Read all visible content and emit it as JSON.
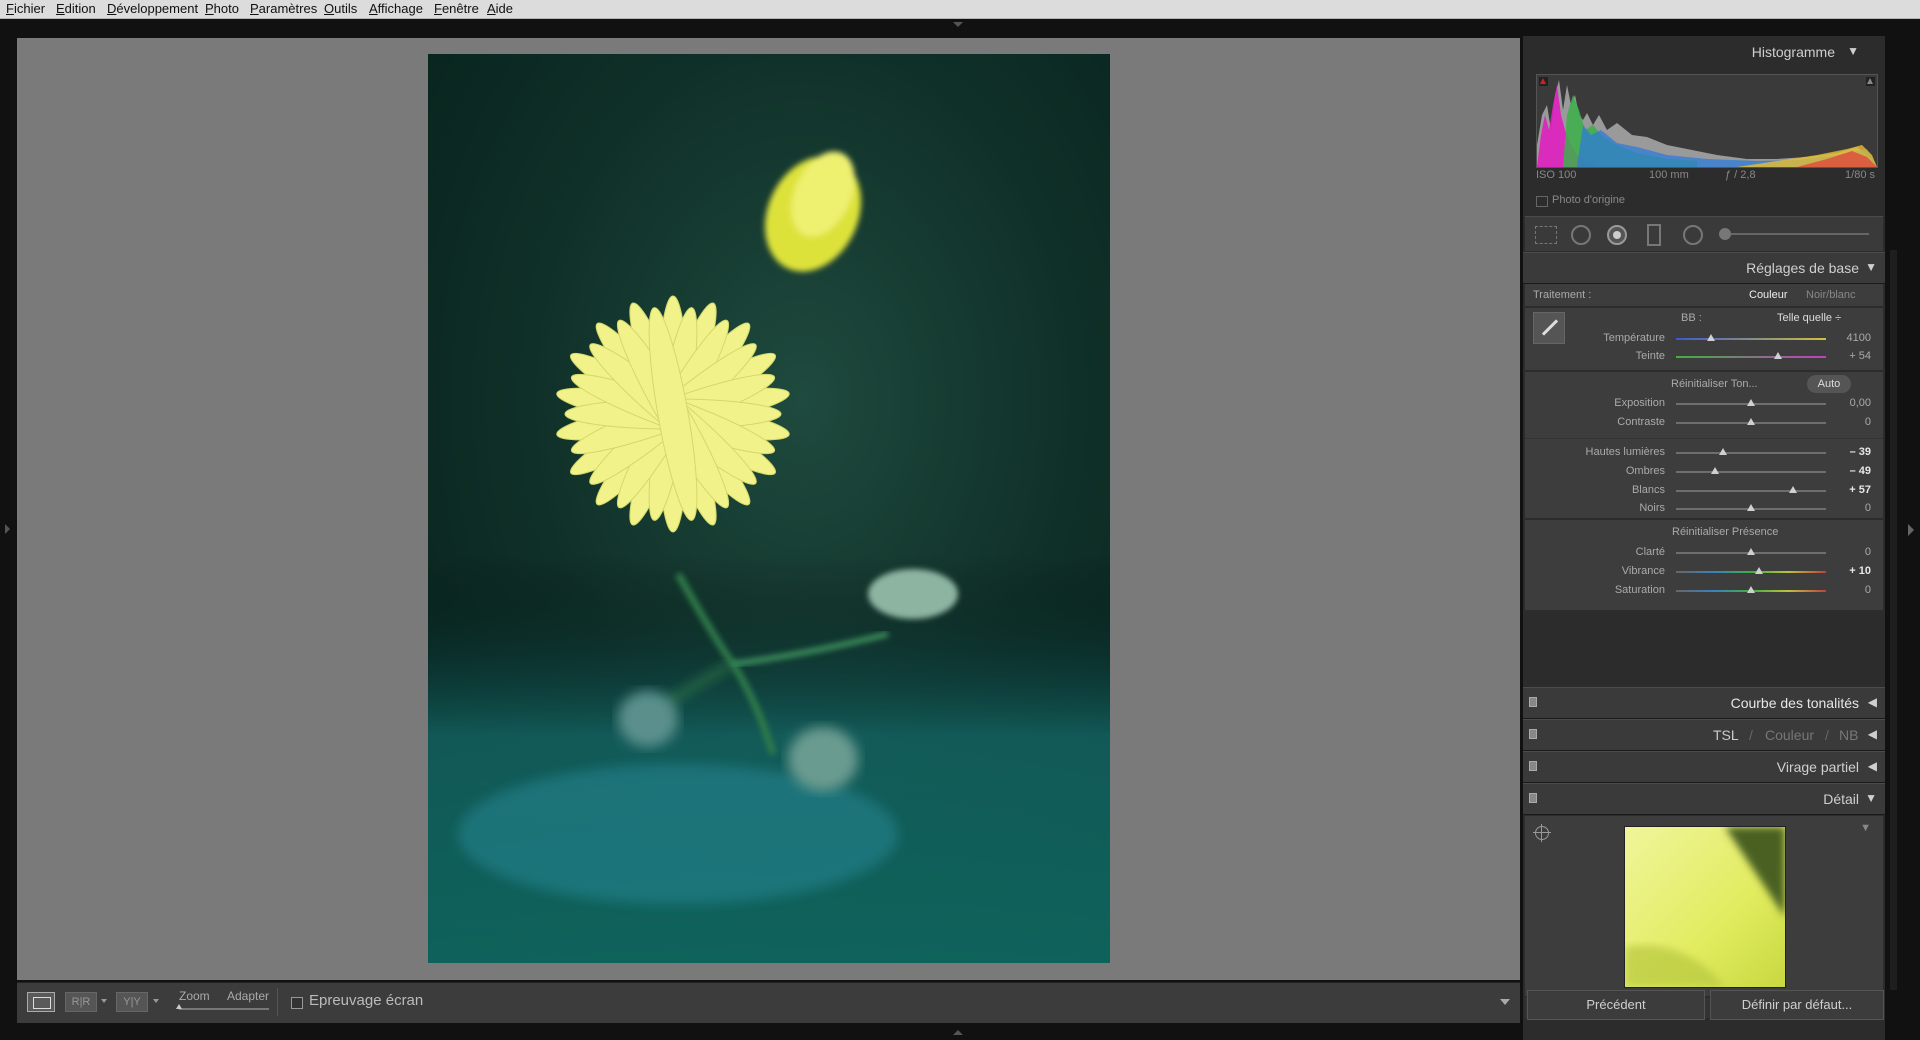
{
  "menu": [
    "Fichier",
    "Edition",
    "Développement",
    "Photo",
    "Paramètres",
    "Outils",
    "Affichage",
    "Fenêtre",
    "Aide"
  ],
  "toolbar": {
    "zoom_label": "Zoom",
    "fit_label": "Adapter",
    "softproof_label": "Epreuvage écran"
  },
  "histogram": {
    "title": "Histogramme",
    "iso": "ISO 100",
    "focal": "100 mm",
    "aperture": "ƒ / 2,8",
    "shutter": "1/80 s",
    "original_photo_label": "Photo d'origine"
  },
  "basic": {
    "title": "Réglages de base",
    "treatment_label": "Traitement :",
    "color_label": "Couleur",
    "bw_label": "Noir/blanc",
    "wb_label": "BB :",
    "wb_value": "Telle quelle ÷",
    "temp_sliders": [
      {
        "label": "Température",
        "value": "4100",
        "pos": 0.23
      },
      {
        "label": "Teinte",
        "value": "+ 54",
        "pos": 0.68
      }
    ],
    "tone_reset_label": "Réinitialiser Ton...",
    "auto_label": "Auto",
    "tone_sliders": [
      {
        "label": "Exposition",
        "value": "0,00",
        "pos": 0.5
      },
      {
        "label": "Contraste",
        "value": "0",
        "pos": 0.5
      }
    ],
    "tone_sliders2": [
      {
        "label": "Hautes lumières",
        "value": "– 39",
        "pos": 0.31
      },
      {
        "label": "Ombres",
        "value": "– 49",
        "pos": 0.26
      },
      {
        "label": "Blancs",
        "value": "+ 57",
        "pos": 0.78
      },
      {
        "label": "Noirs",
        "value": "0",
        "pos": 0.5
      }
    ],
    "presence_reset_label": "Réinitialiser Présence",
    "presence_sliders": [
      {
        "label": "Clarté",
        "value": "0",
        "pos": 0.5
      },
      {
        "label": "Vibrance",
        "value": "+ 10",
        "pos": 0.55
      },
      {
        "label": "Saturation",
        "value": "0",
        "pos": 0.5
      }
    ]
  },
  "panels": {
    "tone_curve": "Courbe des tonalités",
    "tsl": "TSL",
    "couleur": "Couleur",
    "nb": "NB",
    "split_toning": "Virage partiel",
    "detail": "Détail"
  },
  "buttons": {
    "previous": "Précédent",
    "set_default": "Définir par défaut..."
  },
  "colors": {
    "accent": "#cfcfcf",
    "panel_bg": "#3d3d3d",
    "canvas_bg": "#7a7a7a",
    "flower_yellow": "#f2f27a"
  }
}
